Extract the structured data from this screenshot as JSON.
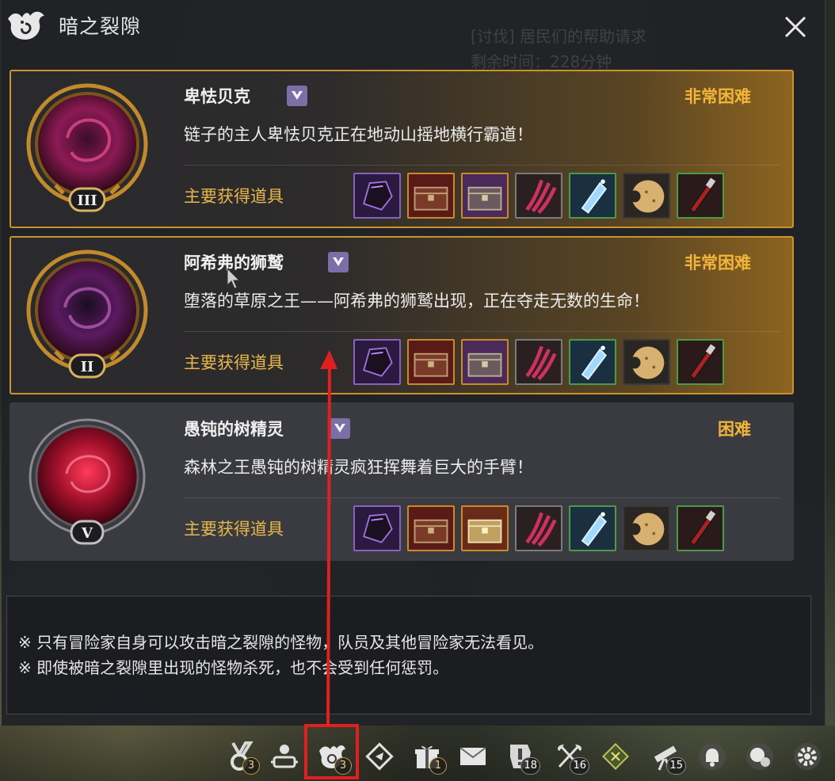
{
  "window": {
    "title": "暗之裂隙",
    "bg_quest_title": "[讨伐] 居民们的帮助请求",
    "bg_quest_time": "剩余时间：228分钟"
  },
  "rifts": [
    {
      "name": "卑怯贝克",
      "difficulty": "非常困难",
      "description": "链子的主人卑怯贝克正在地动山摇地横行霸道！",
      "rank": "III",
      "reward_label": "主要获得道具",
      "style": "hard-plus"
    },
    {
      "name": "阿希弗的狮鹫",
      "difficulty": "非常困难",
      "description": "堕落的草原之王——阿希弗的狮鹫出现，正在夺走无数的生命！",
      "rank": "II",
      "reward_label": "主要获得道具",
      "style": "hard-plus"
    },
    {
      "name": "愚钝的树精灵",
      "difficulty": "困难",
      "description": "森林之王愚钝的树精灵疯狂挥舞着巨大的手臂！",
      "rank": "V",
      "reward_label": "主要获得道具",
      "style": "hard"
    }
  ],
  "reward_items": [
    "armor-icon",
    "red-chest-icon",
    "purple-chest-icon",
    "claw-mark-icon",
    "crystal-shard-icon",
    "cookie-icon",
    "dagger-icon"
  ],
  "notice": {
    "line1": "※ 只有冒险家自身可以攻击暗之裂隙的怪物，队员及其他冒险家无法看见。",
    "line2": "※ 即使被暗之裂隙里出现的怪物杀死，也不会受到任何惩罚。"
  },
  "taskbar": [
    {
      "name": "medal-icon",
      "count": "3"
    },
    {
      "name": "party-icon",
      "count": ""
    },
    {
      "name": "dark-rift-icon",
      "count": "3"
    },
    {
      "name": "compass-icon",
      "count": ""
    },
    {
      "name": "gift-icon",
      "count": "1"
    },
    {
      "name": "mail-icon",
      "count": ""
    },
    {
      "name": "quest-alert-icon",
      "count": "18"
    },
    {
      "name": "crossed-axes-icon",
      "count": "16"
    },
    {
      "name": "diamond-cross-icon",
      "count": ""
    },
    {
      "name": "telescope-icon",
      "count": "15"
    },
    {
      "name": "bell-icon",
      "count": ""
    },
    {
      "name": "chat-bubble-icon",
      "count": ""
    },
    {
      "name": "settings-gear-icon",
      "count": ""
    }
  ],
  "colors": {
    "accent_gold": "#f3b53a",
    "highlight_red": "#e02020",
    "border_gold": "#c9932b"
  }
}
